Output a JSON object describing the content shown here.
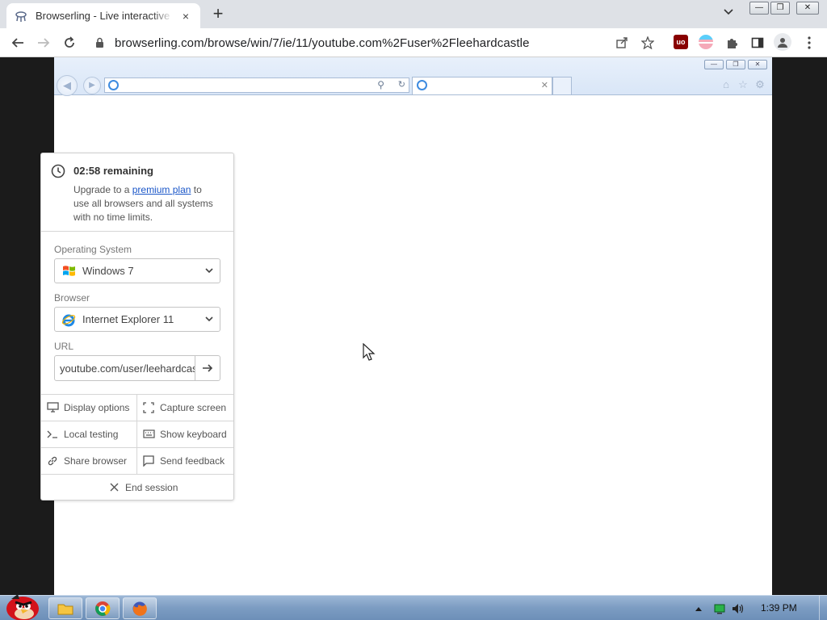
{
  "chrome": {
    "tab_title": "Browserling - Live interactive cross-browser testing",
    "tab_close": "×",
    "new_tab": "+",
    "address_url": "browserling.com/browse/win/7/ie/11/youtube.com%2Fuser%2Fleehardcastle",
    "extensions": [
      "uBlock Origin",
      "pride-extension",
      "extensions-puzzle",
      "side-panel",
      "profile"
    ]
  },
  "panel": {
    "timer": {
      "remaining": "02:58 remaining",
      "upgrade_prefix": "Upgrade to a ",
      "upgrade_link": "premium plan",
      "upgrade_suffix": " to use all browsers and all systems with no time limits."
    },
    "os_label": "Operating System",
    "os_value": "Windows 7",
    "browser_label": "Browser",
    "browser_value": "Internet Explorer 11",
    "url_label": "URL",
    "url_value": "youtube.com/user/leehardcastle",
    "actions": {
      "display_options": "Display options",
      "capture_screen": "Capture screen",
      "local_testing": "Local testing",
      "show_keyboard": "Show keyboard",
      "share_browser": "Share browser",
      "send_feedback": "Send feedback",
      "end_session": "End session"
    }
  },
  "taskbar": {
    "clock": "1:39 PM"
  },
  "colors": {
    "link": "#1a56c8",
    "taskbar": "#7c9cc2",
    "chrome_tabbar": "#dee1e6"
  }
}
